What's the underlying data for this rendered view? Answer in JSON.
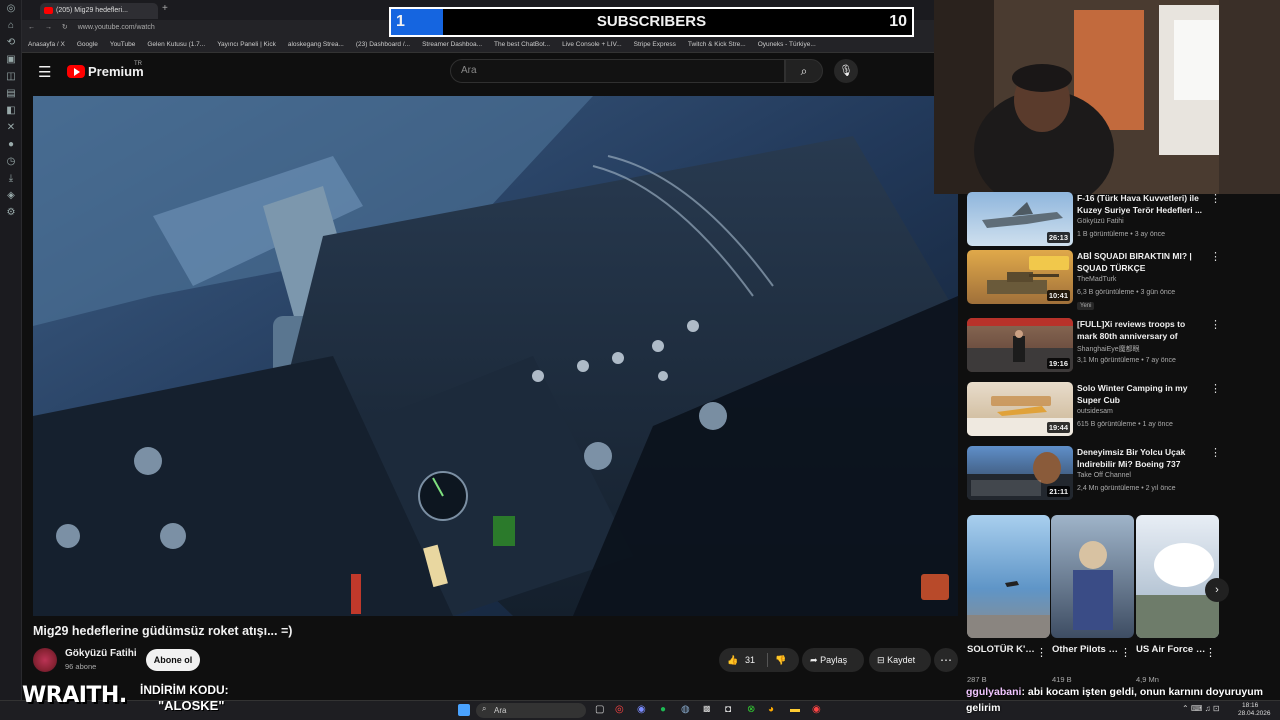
{
  "browser": {
    "tab_title": "(205) Mig29 hedefleri...",
    "address": "www.youtube.com/watch",
    "bookmarks": [
      "Anasayfa / X",
      "Google",
      "YouTube",
      "Gelen Kutusu (1.7...",
      "Yayıncı Paneli | Kick",
      "aloskegang Strea...",
      "(23) Dashboard /...",
      "Streamer Dashboa...",
      "The best ChatBot...",
      "Live Console + LIV...",
      "Stripe Express",
      "Twitch & Kick Stre...",
      "Oyuneks - Türkiye..."
    ]
  },
  "header": {
    "logo": "Premium",
    "logo_sup": "TR",
    "search_placeholder": "Ara"
  },
  "subscriber_goal": {
    "current": "1",
    "label": "SUBSCRIBERS",
    "goal": "10",
    "progress": 0.1,
    "fill_color": "#1565e0"
  },
  "video": {
    "title": "Mig29 hedeflerine güdümsüz roket atışı... =)",
    "channel": "Gökyüzü Fatihi",
    "channel_subs": "96 abone",
    "subscribe_label": "Abone ol",
    "likes": "31",
    "share_label": "Paylaş",
    "save_label": "Kaydet"
  },
  "recommendations": [
    {
      "title": "F-16 (Türk Hava Kuvvetleri) ile Kuzey Suriye Terör Hedefleri ...",
      "channel": "Gökyüzü Fatihi",
      "meta": "1 B görüntüleme • 3 ay önce",
      "duration": "26:13",
      "badge": ""
    },
    {
      "title": "ABİ SQUADI BIRAKTIN MI? | SQUAD TÜRKÇE",
      "channel": "TheMadTurk",
      "meta": "6,3 B görüntüleme • 3 gün önce",
      "duration": "10:41",
      "badge": "Yeni"
    },
    {
      "title": "[FULL]Xi reviews troops to mark 80th anniversary of victory ov...",
      "channel": "ShanghaiEye魔都眼",
      "meta": "3,1 Mn görüntüleme • 7 ay önce",
      "duration": "19:16",
      "badge": ""
    },
    {
      "title": "Solo Winter Camping in my Super Cub",
      "channel": "outsidesam",
      "meta": "615 B görüntüleme • 1 ay önce",
      "duration": "19:44",
      "badge": ""
    },
    {
      "title": "Deneyimsiz Bir Yolcu Uçak İndirebilir Mi? Boeing 737 Yolc...",
      "channel": "Take Off Channel",
      "meta": "2,4 Mn görüntüleme • 2 yıl önce",
      "duration": "21:11",
      "badge": ""
    }
  ],
  "shorts": [
    {
      "title": "SOLOTÜR K'ün Rüzga...",
      "views": "287 B"
    },
    {
      "title": "Other Pilots vs WWII Pil...",
      "views": "419 B"
    },
    {
      "title": "US Air Force Unreal Soni...",
      "views": "4,9 Mn"
    }
  ],
  "overlay": {
    "brand": "WRAITH.",
    "promo_label": "İNDİRİM KODU:",
    "promo_code": "\"ALOSKE\"",
    "chat_user": "ggulyabani",
    "chat_msg": ": abi kocam işten geldi, onun karnını doyuruyum gelirim"
  },
  "taskbar": {
    "search": "Ara",
    "time": "18:16",
    "date": "28.04.2026"
  }
}
